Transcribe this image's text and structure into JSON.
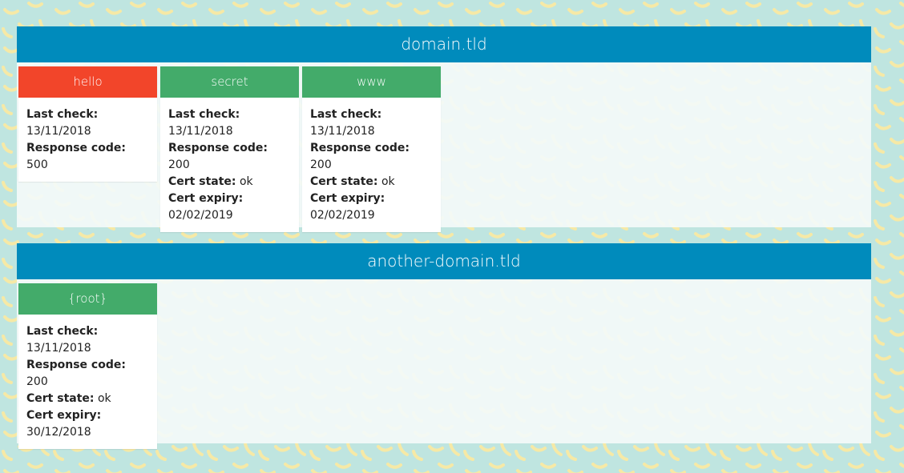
{
  "colors": {
    "page_background": "#bfe5e0",
    "section_header": "#008bbc",
    "status_error": "#f2452a",
    "status_ok": "#43ab6a",
    "banana": "#f6e9a6"
  },
  "labels": {
    "last_check": "Last check:",
    "response_code": "Response code:",
    "cert_state": "Cert state:",
    "cert_expiry": "Cert expiry:"
  },
  "domains": [
    {
      "name": "domain.tld",
      "subdomains": [
        {
          "name": "hello",
          "status": "error",
          "last_check": "13/11/2018",
          "response_code": "500"
        },
        {
          "name": "secret",
          "status": "ok",
          "last_check": "13/11/2018",
          "response_code": "200",
          "cert_state": "ok",
          "cert_expiry": "02/02/2019"
        },
        {
          "name": "www",
          "status": "ok",
          "last_check": "13/11/2018",
          "response_code": "200",
          "cert_state": "ok",
          "cert_expiry": "02/02/2019"
        }
      ]
    },
    {
      "name": "another-domain.tld",
      "subdomains": [
        {
          "name": "{root}",
          "status": "ok",
          "last_check": "13/11/2018",
          "response_code": "200",
          "cert_state": "ok",
          "cert_expiry": "30/12/2018"
        }
      ]
    }
  ]
}
